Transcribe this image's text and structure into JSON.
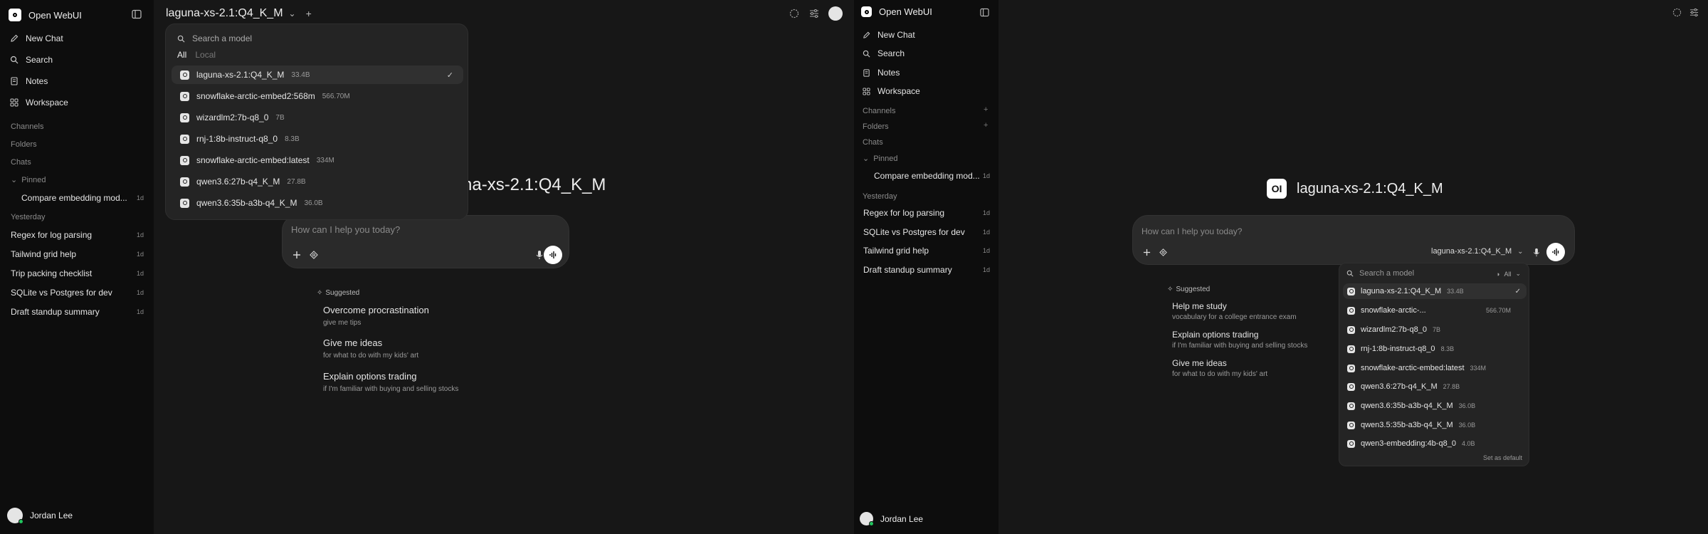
{
  "left": {
    "sidebar": {
      "brand": "Open WebUI",
      "nav": [
        {
          "label": "New Chat",
          "icon": "pencil-icon"
        },
        {
          "label": "Search",
          "icon": "search-icon"
        },
        {
          "label": "Notes",
          "icon": "notes-icon"
        },
        {
          "label": "Workspace",
          "icon": "workspace-icon"
        }
      ],
      "sections": {
        "channels": "Channels",
        "folders": "Folders",
        "chats": "Chats",
        "pinned": "Pinned",
        "yesterday": "Yesterday"
      },
      "pinned_chats": [
        {
          "title": "Compare embedding mod...",
          "age": "1d"
        }
      ],
      "yesterday_chats": [
        {
          "title": "Regex for log parsing",
          "age": "1d"
        },
        {
          "title": "Tailwind grid help",
          "age": "1d"
        },
        {
          "title": "Trip packing checklist",
          "age": "1d"
        },
        {
          "title": "SQLite vs Postgres for dev",
          "age": "1d"
        },
        {
          "title": "Draft standup summary",
          "age": "1d"
        }
      ],
      "user": "Jordan Lee"
    },
    "header": {
      "model": "laguna-xs-2.1:Q4_K_M",
      "add": "+"
    },
    "dropdown": {
      "search_placeholder": "Search a model",
      "tabs": [
        "All",
        "Local"
      ],
      "models": [
        {
          "name": "laguna-xs-2.1:Q4_K_M",
          "size": "33.4B",
          "selected": true
        },
        {
          "name": "snowflake-arctic-embed2:568m",
          "size": "566.70M"
        },
        {
          "name": "wizardlm2:7b-q8_0",
          "size": "7B"
        },
        {
          "name": "rnj-1:8b-instruct-q8_0",
          "size": "8.3B"
        },
        {
          "name": "snowflake-arctic-embed:latest",
          "size": "334M"
        },
        {
          "name": "qwen3.6:27b-q4_K_M",
          "size": "27.8B"
        },
        {
          "name": "qwen3.6:35b-a3b-q4_K_M",
          "size": "36.0B"
        }
      ]
    },
    "hero_visible": "na-xs-2.1:Q4_K_M",
    "chat_placeholder": "How can I help you today?",
    "suggested_label": "Suggested",
    "suggestions": [
      {
        "title": "Overcome procrastination",
        "sub": "give me tips"
      },
      {
        "title": "Give me ideas",
        "sub": "for what to do with my kids' art"
      },
      {
        "title": "Explain options trading",
        "sub": "if I'm familiar with buying and selling stocks"
      }
    ]
  },
  "right": {
    "sidebar": {
      "brand": "Open WebUI",
      "nav": [
        {
          "label": "New Chat",
          "icon": "pencil-icon"
        },
        {
          "label": "Search",
          "icon": "search-icon"
        },
        {
          "label": "Notes",
          "icon": "notes-icon"
        },
        {
          "label": "Workspace",
          "icon": "workspace-icon"
        }
      ],
      "sections": {
        "channels": "Channels",
        "folders": "Folders",
        "chats": "Chats",
        "pinned": "Pinned",
        "yesterday": "Yesterday"
      },
      "pinned_chats": [
        {
          "title": "Compare embedding mod...",
          "age": "1d"
        }
      ],
      "yesterday_chats": [
        {
          "title": "Regex for log parsing",
          "age": "1d"
        },
        {
          "title": "SQLite vs Postgres for dev",
          "age": "1d"
        },
        {
          "title": "Tailwind grid help",
          "age": "1d"
        },
        {
          "title": "Draft standup summary",
          "age": "1d"
        }
      ],
      "user": "Jordan Lee"
    },
    "hero_model": "laguna-xs-2.1:Q4_K_M",
    "chat_placeholder": "How can I help you today?",
    "input_model": "laguna-xs-2.1:Q4_K_M",
    "suggested_label": "Suggested",
    "suggestions": [
      {
        "title": "Help me study",
        "sub": "vocabulary for a college entrance exam"
      },
      {
        "title": "Explain options trading",
        "sub": "if I'm familiar with buying and selling stocks"
      },
      {
        "title": "Give me ideas",
        "sub": "for what to do with my kids' art"
      }
    ],
    "dropdown": {
      "search_placeholder": "Search a model",
      "filter": "All",
      "models": [
        {
          "name": "laguna-xs-2.1:Q4_K_M",
          "size": "33.4B",
          "selected": true
        },
        {
          "name": "snowflake-arctic-...",
          "size": "566.70M"
        },
        {
          "name": "wizardlm2:7b-q8_0",
          "size": "7B"
        },
        {
          "name": "rnj-1:8b-instruct-q8_0",
          "size": "8.3B"
        },
        {
          "name": "snowflake-arctic-embed:latest",
          "size": "334M"
        },
        {
          "name": "qwen3.6:27b-q4_K_M",
          "size": "27.8B"
        },
        {
          "name": "qwen3.6:35b-a3b-q4_K_M",
          "size": "36.0B"
        },
        {
          "name": "qwen3.5:35b-a3b-q4_K_M",
          "size": "36.0B"
        },
        {
          "name": "qwen3-embedding:4b-q8_0",
          "size": "4.0B"
        }
      ],
      "set_default": "Set as default"
    }
  }
}
